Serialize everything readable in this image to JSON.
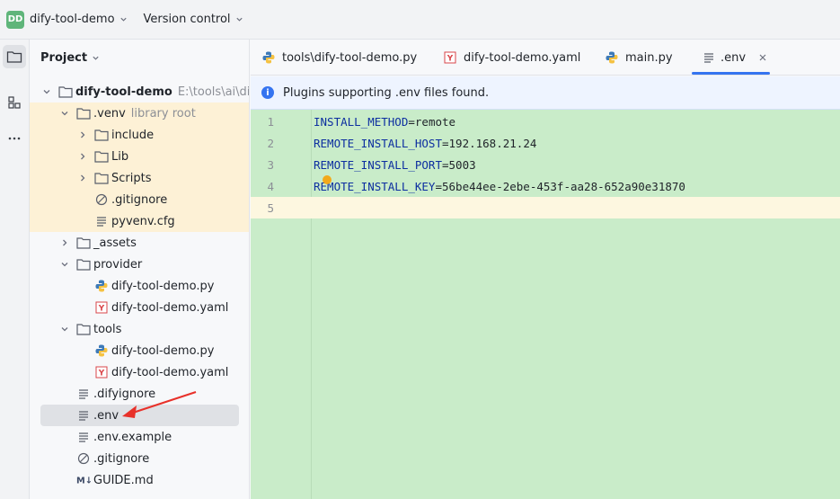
{
  "titlebar": {
    "badge": "DD",
    "project_name": "dify-tool-demo",
    "vcs_label": "Version control"
  },
  "panel": {
    "title": "Project"
  },
  "tree": [
    {
      "depth": 0,
      "arrow": "down",
      "icon": "folder-icon",
      "label": "dify-tool-demo",
      "bold": true,
      "sub": "E:\\tools\\ai\\difys\\",
      "state": ""
    },
    {
      "depth": 1,
      "arrow": "down",
      "icon": "folder-icon",
      "label": ".venv",
      "sub": "library root",
      "state": "highlight"
    },
    {
      "depth": 2,
      "arrow": "right",
      "icon": "folder-icon",
      "label": "include",
      "state": "highlight"
    },
    {
      "depth": 2,
      "arrow": "right",
      "icon": "folder-icon",
      "label": "Lib",
      "state": "highlight"
    },
    {
      "depth": 2,
      "arrow": "right",
      "icon": "folder-icon",
      "label": "Scripts",
      "state": "highlight"
    },
    {
      "depth": 2,
      "arrow": "",
      "icon": "ignore-file-icon",
      "label": ".gitignore",
      "state": "highlight"
    },
    {
      "depth": 2,
      "arrow": "",
      "icon": "text-file-icon",
      "label": "pyvenv.cfg",
      "state": "highlight"
    },
    {
      "depth": 1,
      "arrow": "right",
      "icon": "folder-icon",
      "label": "_assets",
      "state": ""
    },
    {
      "depth": 1,
      "arrow": "down",
      "icon": "folder-icon",
      "label": "provider",
      "state": ""
    },
    {
      "depth": 2,
      "arrow": "",
      "icon": "python-icon",
      "label": "dify-tool-demo.py",
      "state": ""
    },
    {
      "depth": 2,
      "arrow": "",
      "icon": "yaml-icon",
      "label": "dify-tool-demo.yaml",
      "state": ""
    },
    {
      "depth": 1,
      "arrow": "down",
      "icon": "folder-icon",
      "label": "tools",
      "state": ""
    },
    {
      "depth": 2,
      "arrow": "",
      "icon": "python-icon",
      "label": "dify-tool-demo.py",
      "state": ""
    },
    {
      "depth": 2,
      "arrow": "",
      "icon": "yaml-icon",
      "label": "dify-tool-demo.yaml",
      "state": ""
    },
    {
      "depth": 1,
      "arrow": "",
      "icon": "text-file-icon",
      "label": ".difyignore",
      "state": ""
    },
    {
      "depth": 1,
      "arrow": "",
      "icon": "text-file-icon",
      "label": ".env",
      "state": "selected"
    },
    {
      "depth": 1,
      "arrow": "",
      "icon": "text-file-icon",
      "label": ".env.example",
      "state": ""
    },
    {
      "depth": 1,
      "arrow": "",
      "icon": "ignore-file-icon",
      "label": ".gitignore",
      "state": ""
    },
    {
      "depth": 1,
      "arrow": "",
      "icon": "markdown-icon",
      "label": "GUIDE.md",
      "state": ""
    }
  ],
  "tabs": [
    {
      "icon": "python-icon",
      "label": "tools\\dify-tool-demo.py",
      "active": false
    },
    {
      "icon": "yaml-icon",
      "label": "dify-tool-demo.yaml",
      "active": false
    },
    {
      "icon": "python-icon",
      "label": "main.py",
      "active": false
    },
    {
      "icon": "text-file-icon",
      "label": ".env",
      "active": true
    }
  ],
  "notification": {
    "icon": "info-icon",
    "text": "Plugins supporting .env files found."
  },
  "editor": {
    "lines": [
      {
        "num": "1",
        "key": "INSTALL_METHOD",
        "sep": "=",
        "value": "remote"
      },
      {
        "num": "2",
        "key": "REMOTE_INSTALL_HOST",
        "sep": "=",
        "value": "192.168.21.24"
      },
      {
        "num": "3",
        "key": "REMOTE_INSTALL_PORT",
        "sep": "=",
        "value": "5003"
      },
      {
        "num": "4",
        "key": "REMOTE_INSTALL_KEY",
        "sep": "=",
        "value": "56be44ee-2ebe-453f-aa28-652a90e31870"
      },
      {
        "num": "5",
        "key": "",
        "sep": "",
        "value": ""
      }
    ],
    "current_line": 5
  },
  "colors": {
    "accent": "#3574f0",
    "editor_bg": "#c9ecc9",
    "highlight_bg": "#fdf1d6",
    "arrow_annotation": "#e8312a"
  }
}
